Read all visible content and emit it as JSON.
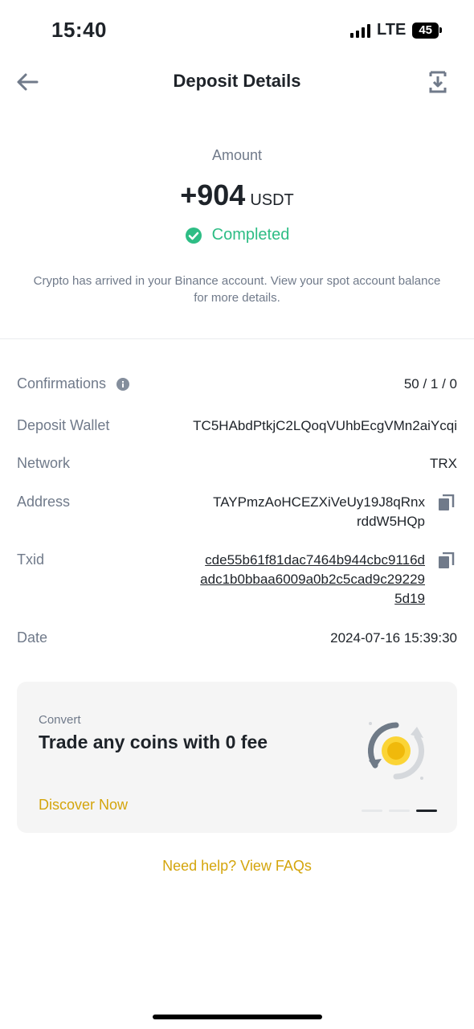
{
  "status_bar": {
    "time": "15:40",
    "network": "LTE",
    "battery": "45"
  },
  "header": {
    "title": "Deposit Details"
  },
  "summary": {
    "amount_label": "Amount",
    "amount": "+904",
    "unit": "USDT",
    "status": "Completed",
    "info": "Crypto has arrived in your Binance account. View your spot account balance for more details."
  },
  "details": {
    "confirmations_label": "Confirmations",
    "confirmations_value": "50 / 1 / 0",
    "wallet_label": "Deposit Wallet",
    "wallet_value": "TC5HAbdPtkjC2LQoqVUhbEcgVMn2aiYcqi",
    "network_label": "Network",
    "network_value": "TRX",
    "address_label": "Address",
    "address_line1": "TAYPmzAoHCEZXiVeUy19J8qRnx",
    "address_line2": "rddW5HQp",
    "txid_label": "Txid",
    "txid_line1": "cde55b61f81dac7464b944cbc9116d",
    "txid_line2": "adc1b0bbaa6009a0b2c5cad9c29229",
    "txid_line3": "5d19",
    "date_label": "Date",
    "date_value": "2024-07-16 15:39:30"
  },
  "promo": {
    "kicker": "Convert",
    "title": "Trade any coins with 0 fee",
    "cta": "Discover Now"
  },
  "help": {
    "link": "Need help? View FAQs"
  },
  "colors": {
    "success": "#2ebd85",
    "accent": "#d4a50c",
    "muted": "#707a8a",
    "text": "#1e2329"
  }
}
